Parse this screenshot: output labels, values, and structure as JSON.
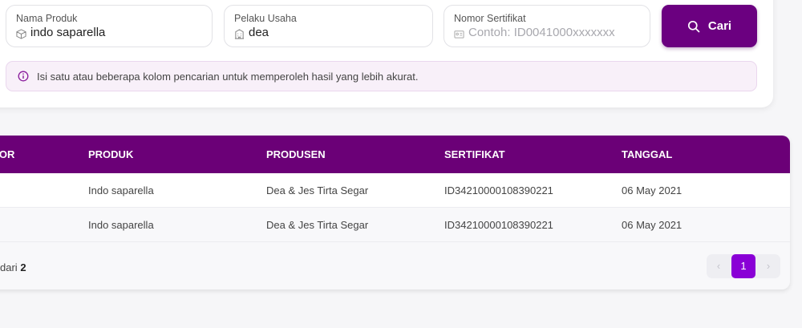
{
  "search": {
    "nama_produk": {
      "label": "Nama Produk",
      "value": "indo saparella"
    },
    "pelaku_usaha": {
      "label": "Pelaku Usaha",
      "value": "dea"
    },
    "nomor_sertifikat": {
      "label": "Nomor Sertifikat",
      "placeholder": "Contoh: ID0041000xxxxxxx"
    },
    "button_label": "Cari",
    "info": "Isi satu atau beberapa kolom pencarian untuk memperoleh hasil yang lebih akurat."
  },
  "table": {
    "columns": [
      "MOR",
      "PRODUK",
      "PRODUSEN",
      "SERTIFIKAT",
      "TANGGAL"
    ],
    "rows": [
      {
        "produk": "Indo saparella",
        "produsen": "Dea & Jes Tirta Segar",
        "sertifikat": "ID34210000108390221",
        "tanggal": "06 May 2021"
      },
      {
        "produk": "Indo saparella",
        "produsen": "Dea & Jes Tirta Segar",
        "sertifikat": "ID34210000108390221",
        "tanggal": "06 May 2021"
      }
    ]
  },
  "footer": {
    "prefix": "dari",
    "total": "2"
  },
  "pagination": {
    "current": "1",
    "prev": "‹",
    "next": "›"
  },
  "colors": {
    "brand": "#6b0080",
    "header": "#6b0077",
    "active_page": "#8a00d6"
  },
  "icons": {
    "nama_produk": "box-icon",
    "pelaku_usaha": "building-icon",
    "nomor_sertifikat": "id-card-icon",
    "button": "search-icon",
    "info": "info-circle-icon"
  }
}
